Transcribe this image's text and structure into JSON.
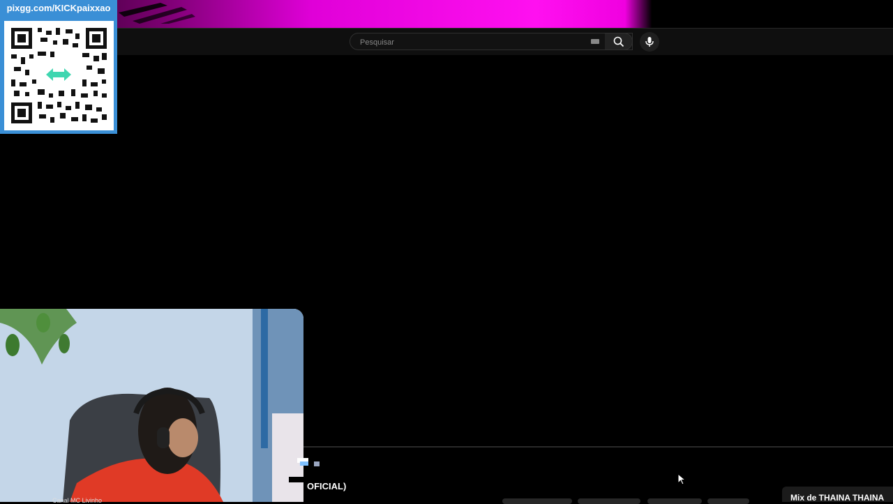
{
  "qr_panel": {
    "url_text": "pixgg.com/KICKpaixxao"
  },
  "header": {
    "search": {
      "placeholder": "Pesquisar"
    }
  },
  "player": {
    "title_fragment": "OFICIAL)",
    "channel_fragment": "Canal MC Livinho"
  },
  "sidebar_next": {
    "mix_label": "Mix de THAINA THAINA"
  },
  "colors": {
    "banner_accent": "#ff10f0",
    "qr_panel_bg": "#3a8fd6",
    "header_bg": "#0f0f0f",
    "page_bg": "#000000"
  },
  "icons": [
    "search-icon",
    "mic-icon",
    "keyboard-icon",
    "qr-code",
    "mouse-cursor-icon"
  ]
}
